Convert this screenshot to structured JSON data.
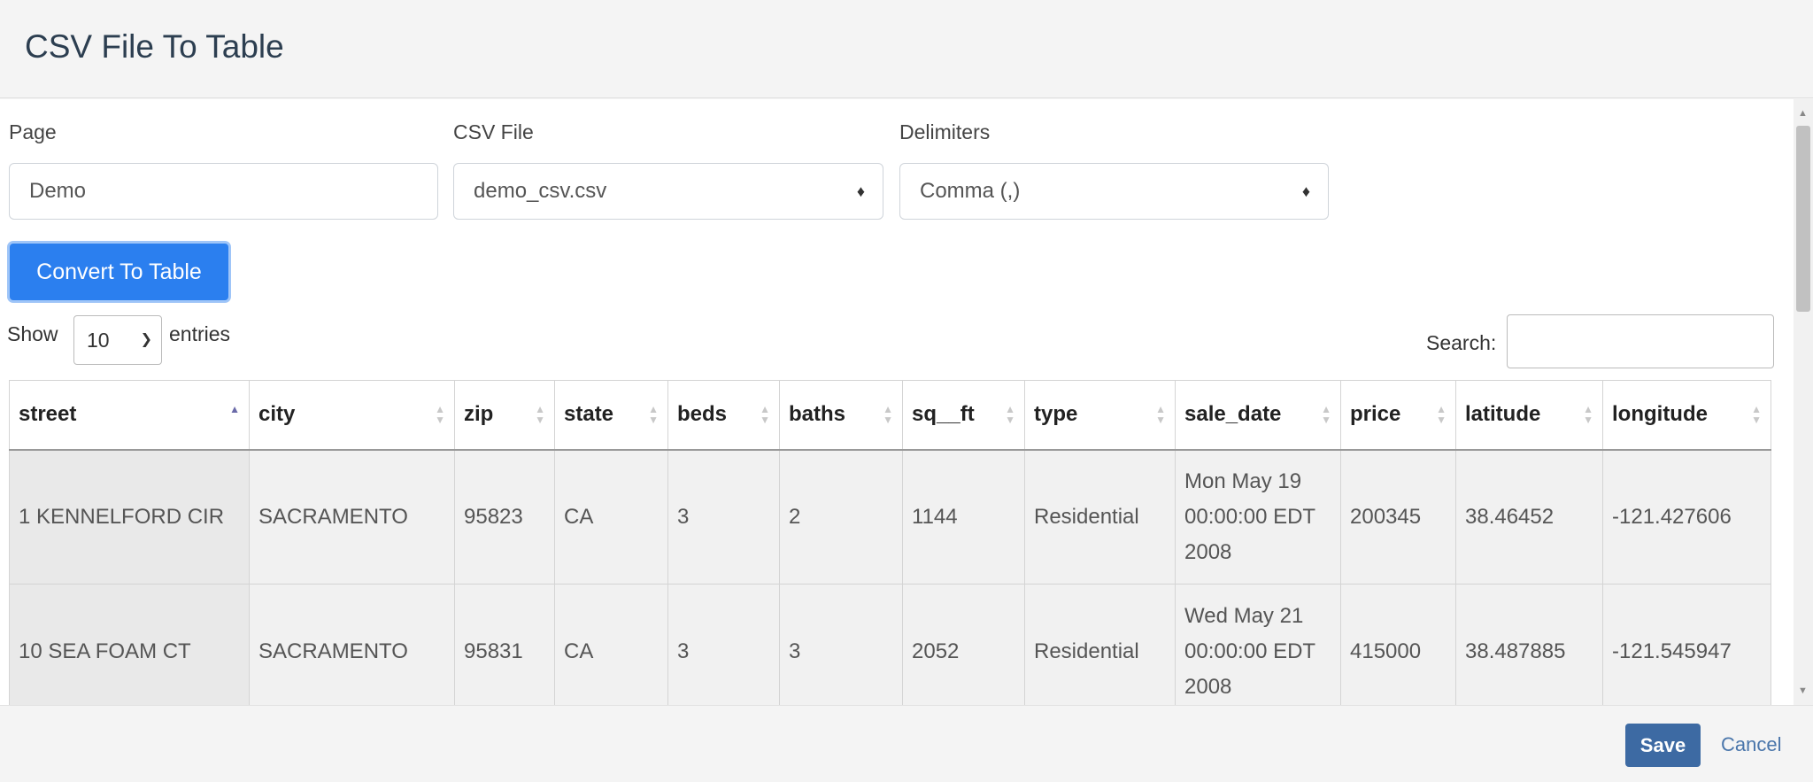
{
  "modal": {
    "title": "CSV File To Table"
  },
  "form": {
    "page_label": "Page",
    "page_value": "Demo",
    "csv_label": "CSV File",
    "csv_value": "demo_csv.csv",
    "delim_label": "Delimiters",
    "delim_value": "Comma (,)",
    "convert_label": "Convert To Table"
  },
  "table_controls": {
    "show_label": "Show",
    "entries_value": "10",
    "entries_label": "entries",
    "search_label": "Search:",
    "search_value": ""
  },
  "table": {
    "headers": [
      "street",
      "city",
      "zip",
      "state",
      "beds",
      "baths",
      "sq__ft",
      "type",
      "sale_date",
      "price",
      "latitude",
      "longitude"
    ],
    "sorted_column": "street",
    "sort_direction": "ascending",
    "rows": [
      [
        "1 KENNELFORD CIR",
        "SACRAMENTO",
        "95823",
        "CA",
        "3",
        "2",
        "1144",
        "Residential",
        "Mon May 19 00:00:00 EDT 2008",
        "200345",
        "38.46452",
        "-121.427606"
      ],
      [
        "10 SEA FOAM CT",
        "SACRAMENTO",
        "95831",
        "CA",
        "3",
        "3",
        "2052",
        "Residential",
        "Wed May 21 00:00:00 EDT 2008",
        "415000",
        "38.487885",
        "-121.545947"
      ]
    ]
  },
  "footer": {
    "save_label": "Save",
    "cancel_label": "Cancel"
  },
  "colors": {
    "primary": "#2b7fef",
    "save": "#3d6aa3",
    "link": "#4a76ab",
    "title": "#2c3e50"
  }
}
